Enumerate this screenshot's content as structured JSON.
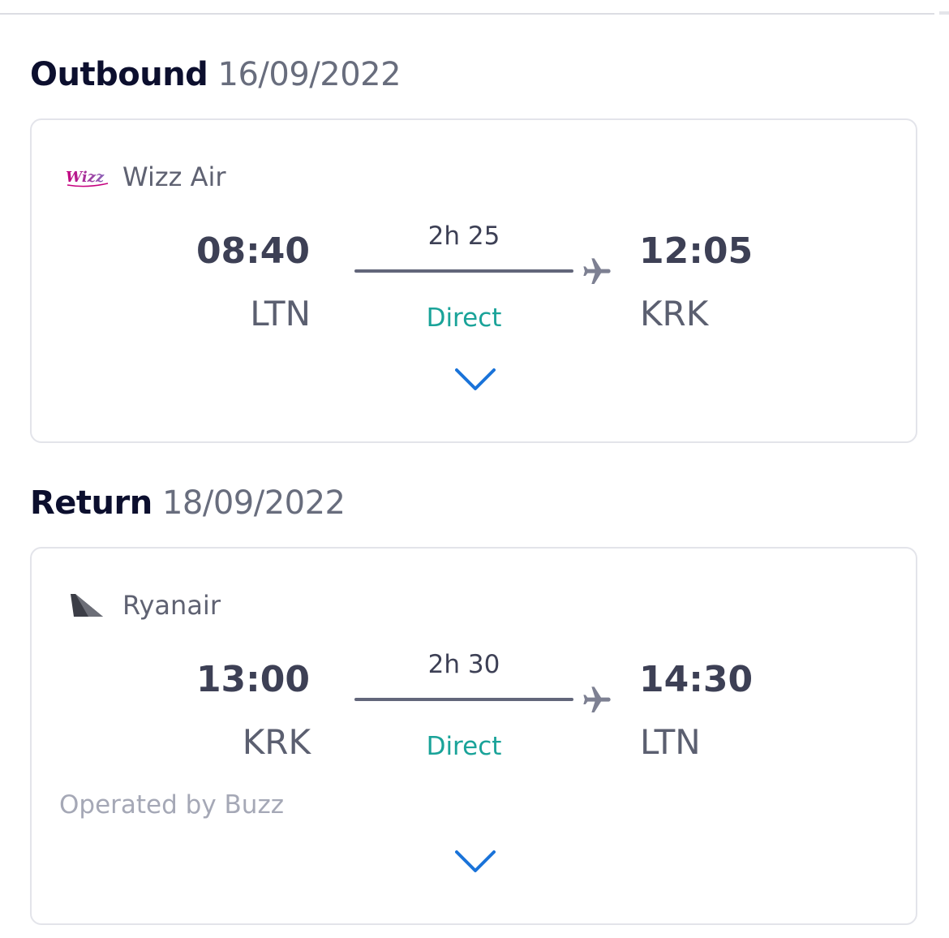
{
  "outbound": {
    "heading": "Outbound",
    "date": "16/09/2022",
    "airline": "Wizz Air",
    "airline_logo": "wizz-air-logo",
    "depart_time": "08:40",
    "depart_code": "LTN",
    "duration": "2h 25",
    "stops": "Direct",
    "arrive_time": "12:05",
    "arrive_code": "KRK",
    "expand_icon": "chevron-down-icon"
  },
  "return": {
    "heading": "Return",
    "date": "18/09/2022",
    "airline": "Ryanair",
    "airline_logo": "ryanair-tail-logo",
    "depart_time": "13:00",
    "depart_code": "KRK",
    "duration": "2h 30",
    "stops": "Direct",
    "arrive_time": "14:30",
    "arrive_code": "LTN",
    "operated_by": "Operated by Buzz",
    "expand_icon": "chevron-down-icon"
  },
  "colors": {
    "heading": "#0c0f2e",
    "date": "#686d7d",
    "time": "#3d4055",
    "direct": "#1aa399",
    "chevron": "#1a73d9",
    "border": "#e3e4ea"
  }
}
